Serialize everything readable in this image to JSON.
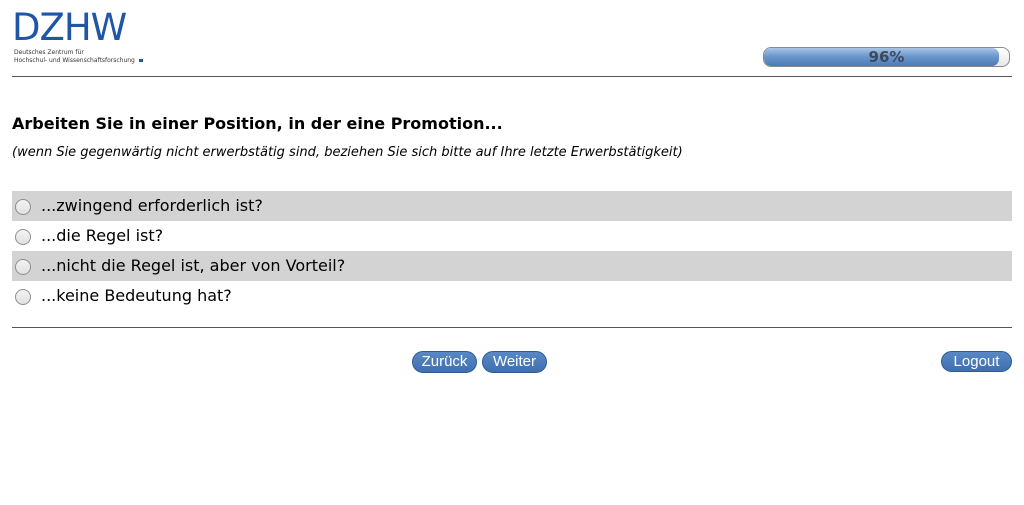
{
  "header": {
    "logo_text": "DZHW",
    "logo_subtitle_line1": "Deutsches Zentrum für",
    "logo_subtitle_line2": "Hochschul- und Wissenschaftsforschung"
  },
  "progress": {
    "value_percent": 96,
    "label": "96%"
  },
  "question": {
    "title": "Arbeiten Sie in einer Position, in der eine Promotion...",
    "hint": "(wenn Sie gegenwärtig nicht erwerbstätig sind, beziehen Sie sich bitte auf Ihre letzte Erwerbstätigkeit)",
    "options": [
      {
        "label": "...zwingend erforderlich ist?"
      },
      {
        "label": "...die Regel ist?"
      },
      {
        "label": "...nicht die Regel ist, aber von Vorteil?"
      },
      {
        "label": "...keine Bedeutung hat?"
      }
    ]
  },
  "nav": {
    "back_label": "Zurück",
    "next_label": "Weiter",
    "logout_label": "Logout"
  },
  "colors": {
    "brand_blue": "#1f56a6",
    "button_blue": "#3e6fae",
    "option_shade": "#d3d3d3"
  }
}
